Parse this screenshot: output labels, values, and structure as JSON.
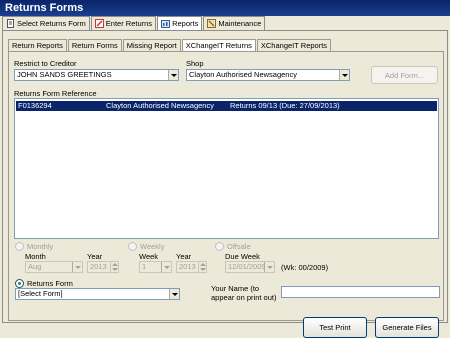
{
  "window": {
    "title": "Returns Forms"
  },
  "main_tabs": [
    {
      "label": "Select Returns Form",
      "icon": "document-icon"
    },
    {
      "label": "Enter Returns",
      "icon": "edit-icon"
    },
    {
      "label": "Reports",
      "icon": "report-icon",
      "active": true
    },
    {
      "label": "Maintenance",
      "icon": "tools-icon"
    }
  ],
  "sub_tabs": [
    {
      "label": "Return Reports"
    },
    {
      "label": "Return Forms"
    },
    {
      "label": "Missing Report"
    },
    {
      "label": "XChangeIT Returns",
      "active": true
    },
    {
      "label": "XChangeIT Reports"
    }
  ],
  "filters": {
    "creditor_label": "Restrict to Creditor",
    "creditor_value": "JOHN SANDS GREETINGS",
    "shop_label": "Shop",
    "shop_value": "Clayton Authorised Newsagency",
    "add_form_button": "Add Form..."
  },
  "list": {
    "header": "Returns Form Reference",
    "rows": [
      {
        "ref": "F0136294",
        "shop": "Clayton Authorised Newsagency",
        "desc": "Returns 09/13  (Due: 27/09/2013)",
        "selected": true
      }
    ]
  },
  "monthly": {
    "label": "Monthly",
    "month_label": "Month",
    "month_value": "Aug",
    "year_label": "Year",
    "year_value": "2013"
  },
  "weekly": {
    "label": "Weekly",
    "week_label": "Week",
    "week_value": "1",
    "year_label": "Year",
    "year_value": "2013"
  },
  "offsale": {
    "label": "Offsale",
    "due_week_label": "Due Week",
    "due_week_value": "12/01/2009",
    "wk_text": "(Wk: 00/2009)"
  },
  "returns_form": {
    "label": "Returns Form",
    "select_value": "[Select Form]"
  },
  "your_name": {
    "label_line1": "Your Name  (to",
    "label_line2": "appear on print out)",
    "value": ""
  },
  "actions": {
    "test_print": "Test Print",
    "generate_files": "Generate Files"
  }
}
